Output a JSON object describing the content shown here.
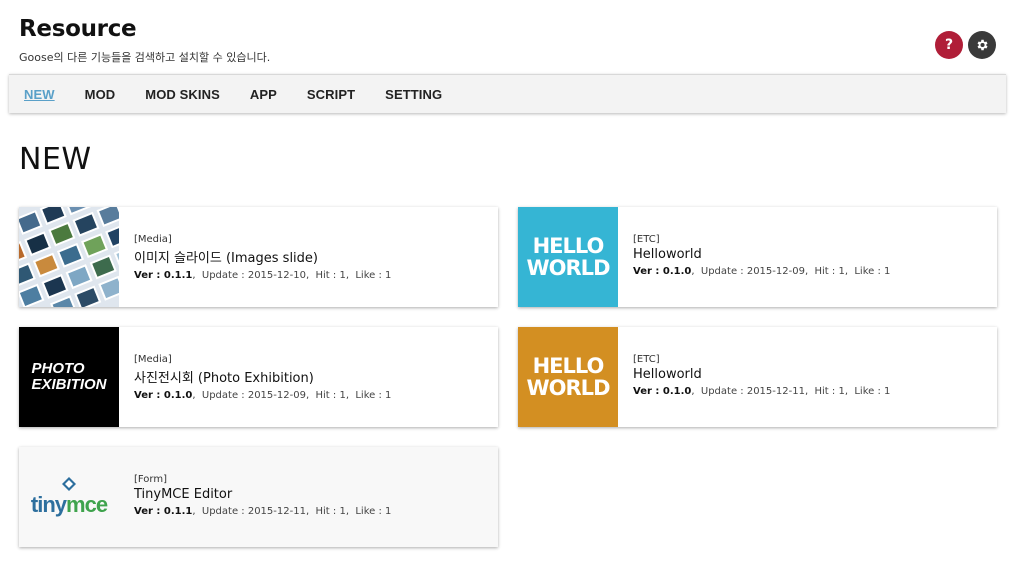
{
  "header": {
    "title": "Resource",
    "subtitle": "Goose의 다른 기능들을 검색하고 설치할 수 있습니다.",
    "help_label": "?"
  },
  "nav": {
    "items": [
      {
        "label": "NEW",
        "active": true
      },
      {
        "label": "MOD"
      },
      {
        "label": "MOD SKINS"
      },
      {
        "label": "APP"
      },
      {
        "label": "SCRIPT"
      },
      {
        "label": "SETTING"
      }
    ]
  },
  "section": {
    "title": "NEW"
  },
  "cards": [
    {
      "category": "[Media]",
      "title": "이미지 슬라이드 (Images slide)",
      "ver_label": "Ver : 0.1.1",
      "update": "Update : 2015-12-10",
      "hit": "Hit : 1",
      "like": "Like : 1",
      "thumb": "images-slide-photo"
    },
    {
      "category": "[ETC]",
      "title": "Helloworld",
      "ver_label": "Ver : 0.1.0",
      "update": "Update : 2015-12-09",
      "hit": "Hit : 1",
      "like": "Like : 1",
      "thumb_text": [
        "HELLO",
        "WORLD"
      ],
      "thumb_color": "#35b5d4"
    },
    {
      "category": "[Media]",
      "title": "사진전시회 (Photo Exhibition)",
      "ver_label": "Ver : 0.1.0",
      "update": "Update : 2015-12-09",
      "hit": "Hit : 1",
      "like": "Like : 1",
      "thumb_text": [
        "PHOTO",
        "EXIBITION"
      ],
      "thumb_color": "#000000"
    },
    {
      "category": "[ETC]",
      "title": "Helloworld",
      "ver_label": "Ver : 0.1.0",
      "update": "Update : 2015-12-11",
      "hit": "Hit : 1",
      "like": "Like : 1",
      "thumb_text": [
        "HELLO",
        "WORLD"
      ],
      "thumb_color": "#d38f22"
    },
    {
      "category": "[Form]",
      "title": "TinyMCE Editor",
      "ver_label": "Ver : 0.1.1",
      "update": "Update : 2015-12-11",
      "hit": "Hit : 1",
      "like": "Like : 1",
      "thumb_text": [
        "tiny",
        "mce"
      ]
    }
  ],
  "colors": {
    "help_button": "#b01e38",
    "settings_button": "#3a3a3a",
    "nav_active": "#5aa0c8"
  }
}
